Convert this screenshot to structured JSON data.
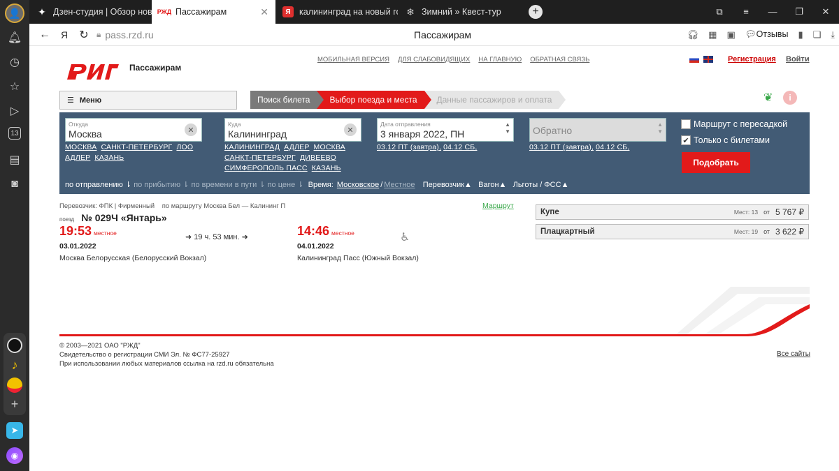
{
  "tabs": [
    {
      "title": "Дзен-студия | Обзор нов",
      "icon": "zen-icon",
      "active": false
    },
    {
      "title": "Пассажирам",
      "icon": "rzd-icon",
      "active": true
    },
    {
      "title": "калининград на новый го",
      "icon": "yandex-icon",
      "active": false
    },
    {
      "title": "Зимний » Квест-тур",
      "icon": "snow-icon",
      "active": false
    }
  ],
  "addressbar": {
    "url": "pass.rzd.ru",
    "page_title": "Пассажирам",
    "feedback": "Отзывы"
  },
  "header": {
    "brand": "Пассажирам",
    "links": [
      "МОБИЛЬНАЯ ВЕРСИЯ",
      "ДЛЯ СЛАБОВИДЯЩИХ",
      "НА ГЛАВНУЮ",
      "ОБРАТНАЯ СВЯЗЬ"
    ],
    "register": "Регистрация",
    "login": "Войти"
  },
  "menu": {
    "label": "Меню"
  },
  "steps": [
    "Поиск билета",
    "Выбор поезда и места",
    "Данные пассажиров и оплата"
  ],
  "search": {
    "from_label": "Откуда",
    "from_value": "Москва",
    "from_quick": [
      "МОСКВА",
      "САНКТ-ПЕТЕРБУРГ",
      "ЛОО",
      "АДЛЕР",
      "КАЗАНЬ"
    ],
    "to_label": "Куда",
    "to_value": "Калининград",
    "to_quick": [
      "КАЛИНИНГРАД",
      "АДЛЕР",
      "МОСКВА",
      "САНКТ-ПЕТЕРБУРГ",
      "ДИВЕЕВО",
      "СИМФЕРОПОЛЬ ПАСС",
      "КАЗАНЬ"
    ],
    "date_label": "Дата отправления",
    "date_value": "3 января 2022, ПН",
    "date_quick": [
      "03.12 ПТ (завтра),",
      "04.12 СБ,"
    ],
    "return_placeholder": "Обратно",
    "return_quick": [
      "03.12 ПТ (завтра),",
      "04.12 СБ,"
    ],
    "transfer_label": "Маршрут с пересадкой",
    "transfer_checked": false,
    "tickets_label": "Только с билетами",
    "tickets_checked": true,
    "submit": "Подобрать"
  },
  "sortbar": {
    "by_departure": "по отправлению",
    "by_arrival": "по прибытию",
    "by_travel_time": "по времени в пути",
    "by_price": "по цене",
    "time_label": "Время:",
    "time_moscow": "Московское",
    "time_sep": "/",
    "time_local": "Местное",
    "carrier": "Перевозчик",
    "wagon": "Вагон",
    "benefits": "Льготы / ФСС"
  },
  "train": {
    "carrier": "Перевозчик: ФПК | Фирменный",
    "route": "по маршруту Москва Бел — Калининг П",
    "route_link": "Маршрут",
    "train_prefix": "поезд",
    "train_number": "№ 029Ч «Янтарь»",
    "dep_time": "19:53",
    "dep_time_kind": "местное",
    "dep_date": "03.01.2022",
    "dep_station": "Москва Белорусская (Белорусский Вокзал)",
    "duration": "19 ч. 53 мин.",
    "arr_time": "14:46",
    "arr_time_kind": "местное",
    "arr_date": "04.01.2022",
    "arr_station": "Калининград Пасс (Южный Вокзал)",
    "cars": [
      {
        "type": "Купе",
        "seats": "Мест: 13",
        "from": "от",
        "price": "5 767 ₽"
      },
      {
        "type": "Плацкартный",
        "seats": "Мест: 19",
        "from": "от",
        "price": "3 622 ₽"
      }
    ]
  },
  "footer": {
    "copyright": "© 2003—2021 ОАО \"РЖД\"",
    "license": "Свидетельство о регистрации СМИ Эл. № ФС77-25927",
    "notice": "При использовании любых материалов ссылка на rzd.ru обязательна",
    "all_sites": "Все сайты"
  },
  "colors": {
    "brand_red": "#e21a1a",
    "panel": "#425b75",
    "link_green": "#3aa84a"
  }
}
